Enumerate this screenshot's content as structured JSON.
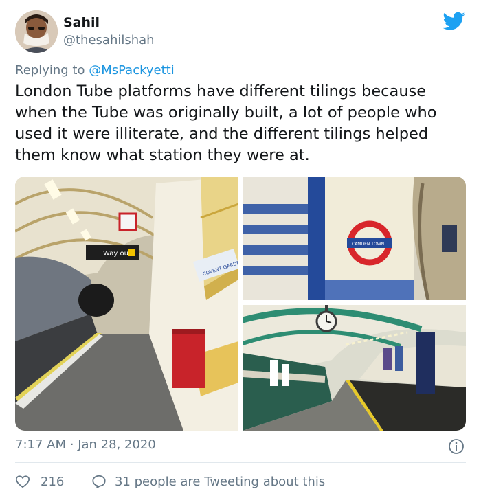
{
  "author": {
    "name": "Sahil",
    "handle": "@thesahilshah"
  },
  "reply": {
    "prefix": "Replying to",
    "mention": "@MsPackyetti"
  },
  "tweet": {
    "text": "London Tube platforms have different tilings because when the Tube was originally built, a lot of people who used it were illiterate, and the different tilings helped them know what station they were at."
  },
  "media": {
    "photo1": {
      "sign": "Way out",
      "station": "COVENT GARDEN"
    },
    "photo2": {
      "roundel": "CAMDEN TOWN"
    }
  },
  "meta": {
    "time": "7:17 AM",
    "separator": "·",
    "date": "Jan 28, 2020"
  },
  "engagement": {
    "likes": "216",
    "conversation": "31 people are Tweeting about this"
  },
  "icons": {
    "brand": "twitter-bird-icon",
    "info": "info-icon",
    "like": "heart-icon",
    "reply": "comment-icon"
  },
  "colors": {
    "brand": "#1da1f2",
    "link": "#1b95e0",
    "secondary": "#657786",
    "like": "#e0245e"
  }
}
